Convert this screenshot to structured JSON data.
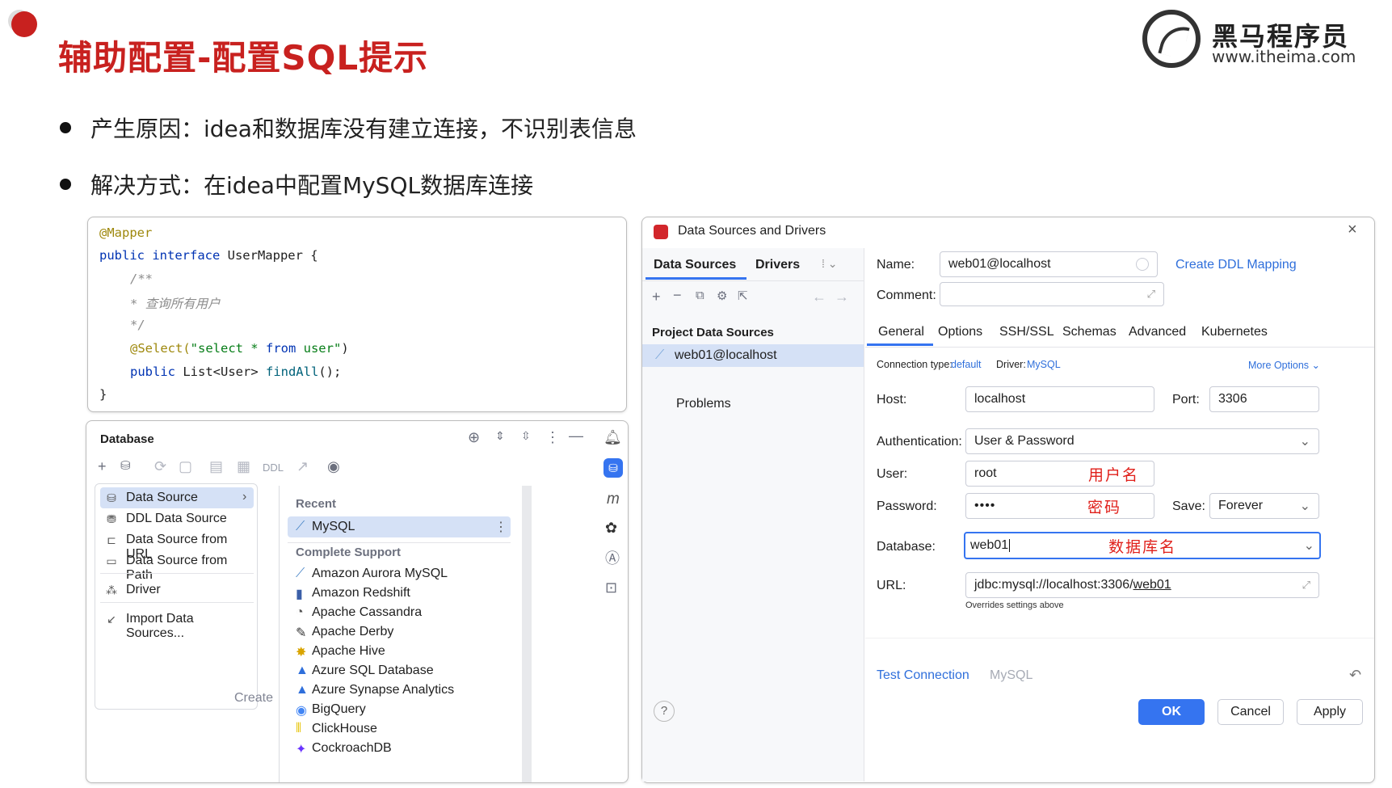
{
  "slide": {
    "title": "辅助配置-配置SQL提示",
    "logo_cn": "黑马程序员",
    "logo_url": "www.itheima.com",
    "bullets": [
      "产生原因：idea和数据库没有建立连接，不识别表信息",
      "解决方式：在idea中配置MySQL数据库连接"
    ]
  },
  "code": {
    "l1": "@Mapper",
    "l2_kw": "public interface",
    "l2_rest": " UserMapper {",
    "l3": "/**",
    "l4": " *  查询所有用户",
    "l5": " */",
    "l6_ann": "@Select(",
    "l6_str1": "\"select * ",
    "l6_kw": "from",
    "l6_str2": " user\"",
    "l6_end": ")",
    "l7_kw": "public",
    "l7_type": " List<User> ",
    "l7_fn": "findAll",
    "l7_end": "();",
    "l8": "}"
  },
  "database_panel": {
    "title": "Database",
    "ddl_label": "DDL",
    "menu": [
      {
        "label": "Data Source",
        "icon": "database-icon"
      },
      {
        "label": "DDL Data Source",
        "icon": "ddl-icon"
      },
      {
        "label": "Data Source from URL",
        "icon": "url-icon"
      },
      {
        "label": "Data Source from Path",
        "icon": "folder-icon"
      },
      {
        "label": "Driver",
        "icon": "driver-icon"
      },
      {
        "label": "Import Data Sources...",
        "icon": "import-icon"
      }
    ],
    "create_hint": "Create",
    "submenu": {
      "recent_header": "Recent",
      "recent": [
        "MySQL"
      ],
      "complete_header": "Complete Support",
      "items": [
        "Amazon Aurora MySQL",
        "Amazon Redshift",
        "Apache Cassandra",
        "Apache Derby",
        "Apache Hive",
        "Azure SQL Database",
        "Azure Synapse Analytics",
        "BigQuery",
        "ClickHouse",
        "CockroachDB"
      ]
    },
    "side_m": "m"
  },
  "dialog": {
    "title": "Data Sources and Drivers",
    "left_tabs": [
      "Data Sources",
      "Drivers"
    ],
    "project_header": "Project Data Sources",
    "source_item": "web01@localhost",
    "problems": "Problems",
    "name_label": "Name:",
    "name_value": "web01@localhost",
    "create_ddl": "Create DDL Mapping",
    "comment_label": "Comment:",
    "tabs": [
      "General",
      "Options",
      "SSH/SSL",
      "Schemas",
      "Advanced",
      "Kubernetes"
    ],
    "conn_type_label": "Connection type:",
    "conn_type_value": "default",
    "driver_label": "Driver:",
    "driver_value": "MySQL",
    "more_options": "More Options",
    "host_label": "Host:",
    "host_value": "localhost",
    "port_label": "Port:",
    "port_value": "3306",
    "auth_label": "Authentication:",
    "auth_value": "User & Password",
    "user_label": "User:",
    "user_value": "root",
    "user_note": "用户名",
    "password_label": "Password:",
    "password_value": "••••",
    "password_note": "密码",
    "save_label": "Save:",
    "save_value": "Forever",
    "database_label": "Database:",
    "database_value": "web01",
    "database_note": "数据库名",
    "url_label": "URL:",
    "url_prefix": "jdbc:mysql://localhost:3306/",
    "url_db": "web01",
    "url_hint": "Overrides settings above",
    "test_connection": "Test Connection",
    "test_driver": "MySQL",
    "ok": "OK",
    "cancel": "Cancel",
    "apply": "Apply",
    "help": "?"
  },
  "colors": {
    "accent": "#2f6fdb",
    "title_red": "#c8211f",
    "selection": "#d5e1f6",
    "ok_button": "#3574f0"
  }
}
